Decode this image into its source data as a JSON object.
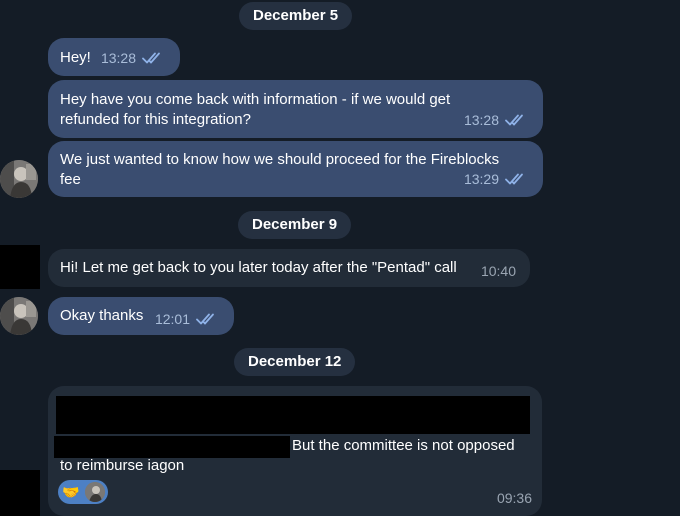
{
  "dates": [
    "December 5",
    "December 9",
    "December 12"
  ],
  "messages": [
    {
      "text": "Hey!",
      "time": "13:28",
      "status": "read"
    },
    {
      "text": "Hey have you come back with information - if we would get refunded for this integration?",
      "time": "13:28",
      "status": "read"
    },
    {
      "text": "We just wanted to know how we should proceed for the Fireblocks fee",
      "time": "13:29",
      "status": "read"
    },
    {
      "text": "Hi! Let me get back to you later today after the \"Pentad\" call",
      "time": "10:40"
    },
    {
      "text": "Okay thanks",
      "time": "12:01",
      "status": "read"
    },
    {
      "text_line1": "But the committee is not opposed",
      "text_line2": "to reimburse iagon",
      "time": "09:36",
      "reaction": "🤝"
    }
  ],
  "colors": {
    "background": "#141c26",
    "outgoing_bubble": "#3a4d70",
    "incoming_bubble": "#222c38",
    "date_pill": "#253040",
    "read_check": "#8fb2e8"
  }
}
